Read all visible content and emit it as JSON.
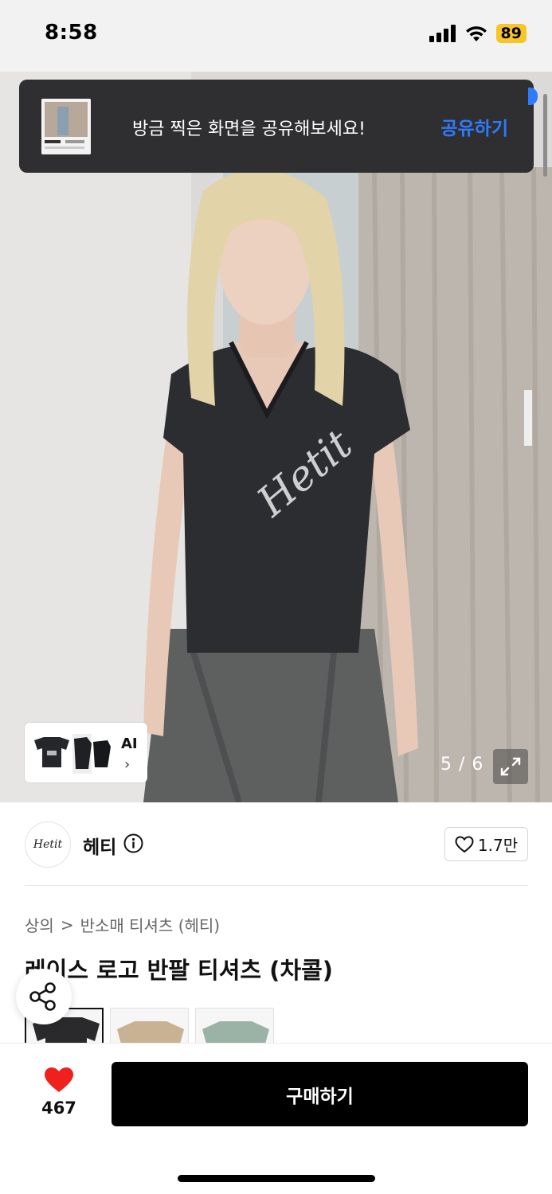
{
  "status_bar": {
    "time": "8:58",
    "battery": "89",
    "signal_icon": "cellular-signal-icon",
    "wifi_icon": "wifi-icon"
  },
  "toast": {
    "message": "방금 찍은 화면을 공유해보세요!",
    "action_label": "공유하기",
    "action_color": "#2e7bff"
  },
  "gallery": {
    "counter": "5 / 6",
    "current_index": 5,
    "total": 6,
    "ai_card_label": "AI",
    "ai_card_chevron": "›",
    "expand_icon": "expand-arrows-icon",
    "logo_print": "Hetit"
  },
  "brand": {
    "logo_text": "Hetit",
    "name": "헤티",
    "info_icon": "info-circle-icon",
    "like_count": "1.7만",
    "like_icon": "heart-outline-icon"
  },
  "breadcrumb": {
    "items": [
      "상의",
      "반소매 티셔츠 (헤티)"
    ],
    "separator": ">"
  },
  "product": {
    "title": "레이스 로고 반팔 티셔츠 (차콜)",
    "color_swatches": [
      {
        "name": "차콜",
        "color": "#2a2a2c",
        "selected": true
      },
      {
        "name": "베이지",
        "color": "#c9b193",
        "selected": false
      },
      {
        "name": "민트",
        "color": "#9ab3a6",
        "selected": false
      }
    ]
  },
  "share_fab": {
    "icon": "share-icon"
  },
  "bottom_bar": {
    "wish_icon": "heart-filled-icon",
    "wish_color": "#f0201c",
    "wish_count": "467",
    "buy_label": "구매하기"
  }
}
